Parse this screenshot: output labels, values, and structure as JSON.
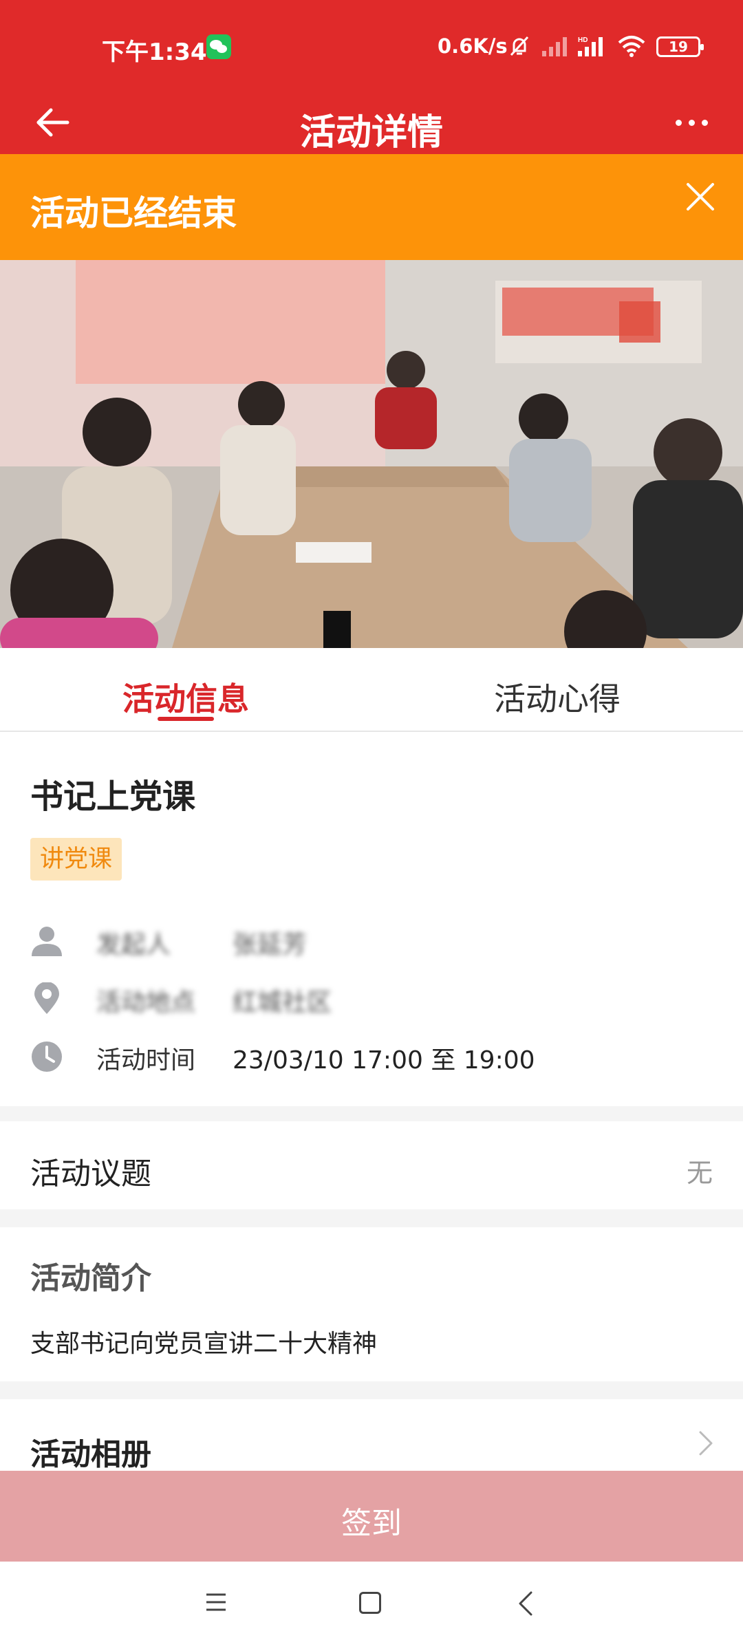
{
  "status_bar": {
    "time": "下午1:34",
    "network_speed": "0.6K/s",
    "battery": "19"
  },
  "header": {
    "title": "活动详情"
  },
  "banner": {
    "text": "活动已经结束"
  },
  "tabs": [
    {
      "label": "活动信息",
      "active": true
    },
    {
      "label": "活动心得",
      "active": false
    }
  ],
  "activity": {
    "title": "书记上党课",
    "category": "讲党课",
    "details": {
      "organizer_label": "发起人",
      "organizer_value": "张延芳",
      "location_label": "活动地点",
      "location_value": "红城社区",
      "time_label": "活动时间",
      "time_value": "23/03/10 17:00 至 19:00"
    }
  },
  "topic": {
    "label": "活动议题",
    "value": "无"
  },
  "intro": {
    "label": "活动简介",
    "text": "支部书记向党员宣讲二十大精神"
  },
  "album": {
    "label": "活动相册"
  },
  "checkin": {
    "label": "签到"
  },
  "colors": {
    "brand_red": "#e02a2a",
    "banner_orange": "#fd9309",
    "badge_text": "#f08a10",
    "checkin_disabled": "#e4a2a4"
  }
}
